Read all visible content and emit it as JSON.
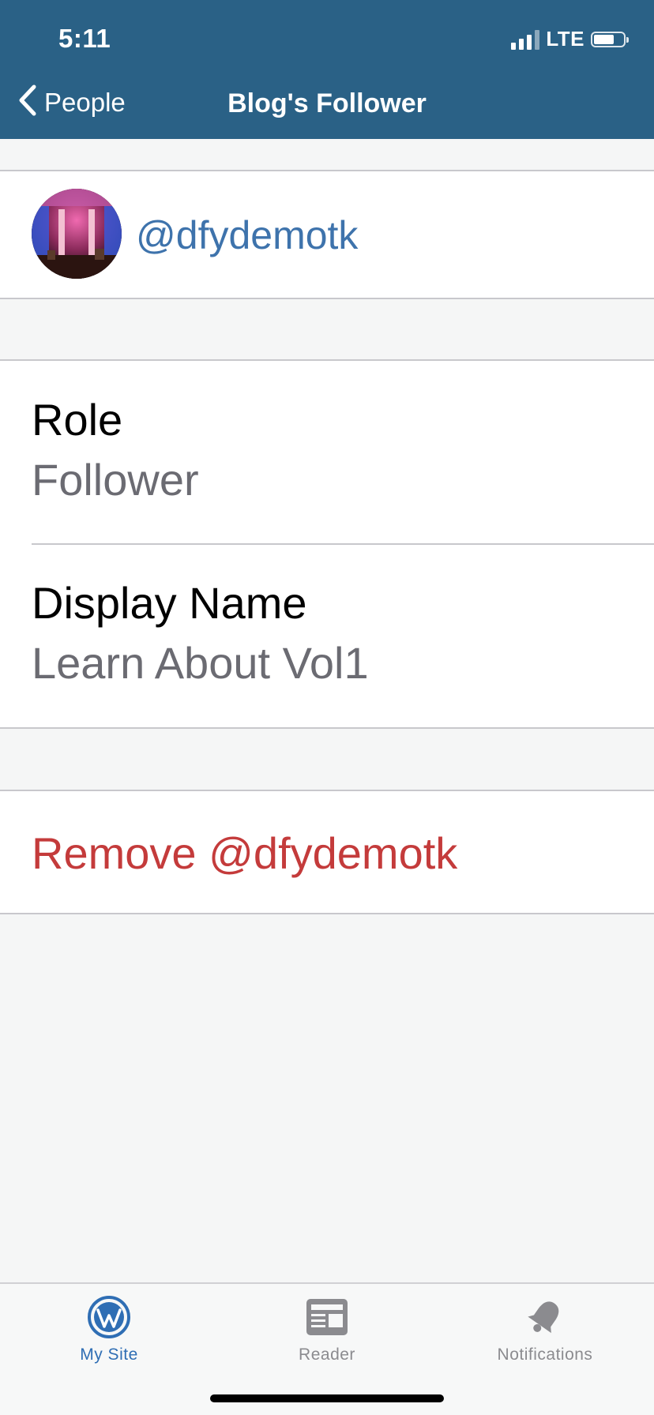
{
  "status_bar": {
    "time": "5:11",
    "network": "LTE"
  },
  "nav": {
    "back_label": "People",
    "title": "Blog's Follower"
  },
  "user": {
    "username": "@dfydemotk"
  },
  "details": {
    "role_label": "Role",
    "role_value": "Follower",
    "display_name_label": "Display Name",
    "display_name_value": "Learn About Vol1"
  },
  "actions": {
    "remove_label": "Remove @dfydemotk"
  },
  "tabbar": {
    "items": [
      {
        "label": "My Site",
        "icon": "wordpress-icon",
        "active": true
      },
      {
        "label": "Reader",
        "icon": "reader-icon",
        "active": false
      },
      {
        "label": "Notifications",
        "icon": "bell-icon",
        "active": false
      }
    ]
  },
  "colors": {
    "header_bg": "#2a6186",
    "link_blue": "#3e73ac",
    "destructive_red": "#c43b3b",
    "tab_active": "#2f6eb4",
    "tab_inactive": "#8b8b8f"
  }
}
